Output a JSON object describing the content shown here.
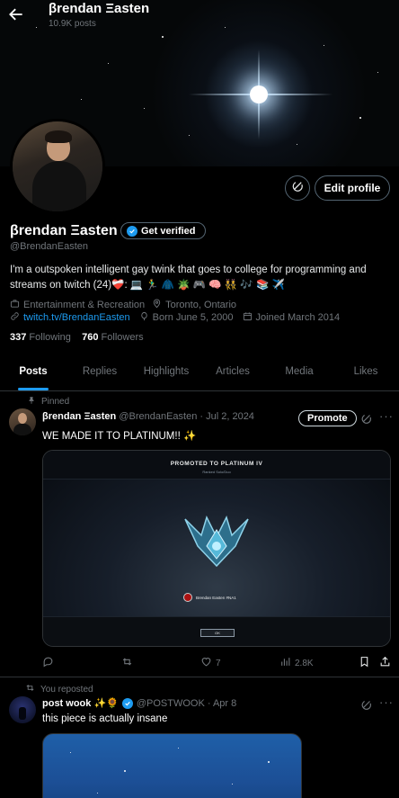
{
  "header": {
    "name": "βrendan Ξasten",
    "posts_count": "10.9K posts"
  },
  "profile": {
    "display_name": "βrendan Ξasten",
    "verify_label": "Get verified",
    "handle": "@BrendanEasten",
    "bio_line1": "I'm a outspoken intelligent gay twink that goes to college for programming and",
    "bio_line2": "streams on twitch (24)❤️‍🩹: 💻 🏃‍♂️ 🧥 🪴 🎮 🧠 👯 🎶 📚 ✈️",
    "category": "Entertainment & Recreation",
    "location": "Toronto, Ontario",
    "website": "twitch.tv/BrendanEasten",
    "birthday": "Born June 5, 2000",
    "joined": "Joined March 2014",
    "following_count": "337",
    "following_label": "Following",
    "followers_count": "760",
    "followers_label": "Followers",
    "edit_label": "Edit profile"
  },
  "tabs": [
    "Posts",
    "Replies",
    "Highlights",
    "Articles",
    "Media",
    "Likes"
  ],
  "tweet1": {
    "pinned_label": "Pinned",
    "name": "βrendan Ξasten",
    "handle_date": "@BrendanEasten · Jul 2, 2024",
    "promote_label": "Promote",
    "text": "WE MADE IT TO PLATINUM!! ✨",
    "media_title": "PROMOTED TO PLATINUM IV",
    "media_sub": "Ranked Solo/Duo",
    "media_player": "Brendan Easten #NA1",
    "media_ok": "OK",
    "replies": "",
    "reposts": "",
    "likes": "7",
    "views": "2.8K"
  },
  "tweet2": {
    "repost_label": "You reposted",
    "name": "post wook ✨🌻",
    "handle_date": "@POSTWOOK · Apr 8",
    "text": "this piece is actually insane"
  },
  "colors": {
    "accent": "#1d9bf0",
    "background": "#000000",
    "muted": "#71767b"
  },
  "icons": [
    "back-arrow-icon",
    "grok-icon",
    "briefcase-icon",
    "location-icon",
    "link-icon",
    "calendar-icon",
    "balloon-icon",
    "pin-icon",
    "repost-icon",
    "reply-icon",
    "like-icon",
    "views-icon",
    "bookmark-icon",
    "share-icon",
    "more-icon",
    "verified-badge-icon"
  ]
}
